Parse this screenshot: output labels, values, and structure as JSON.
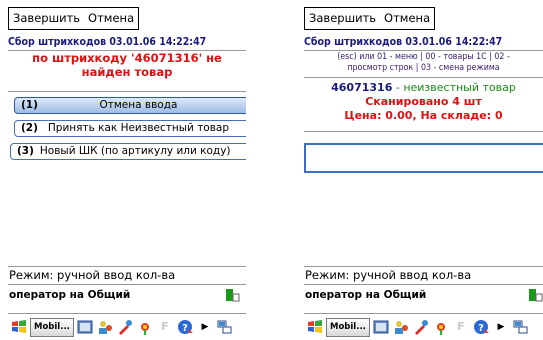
{
  "colors": {
    "error_red": "#e01010",
    "header_blue": "#1a1a80",
    "accent_green": "#1a8a1a",
    "selected_button_blue": "#9ebce6",
    "input_border_blue": "#3a6fc4"
  },
  "left_screen": {
    "menu": {
      "finish_label": "Завершить",
      "cancel_label": "Отмена"
    },
    "header_title": "Сбор штрихкодов 03.01.06 14:22:47",
    "error_message": "по штрихкоду '46071316' не найден товар",
    "options": [
      {
        "num": "(1)",
        "label": "Отмена ввода"
      },
      {
        "num": "(2)",
        "label": "Принять как Неизвестный товар"
      },
      {
        "num": "(3)",
        "label": "Новый ШК (по артикулу или коду)"
      }
    ],
    "mode_text": "Режим: ручной ввод кол-ва",
    "operator_text": "оператор на Общий",
    "taskbar": {
      "app_label": "Mobil..."
    }
  },
  "right_screen": {
    "menu": {
      "finish_label": "Завершить",
      "cancel_label": "Отмена"
    },
    "header_title": "Сбор штрихкодов 03.01.06 14:22:47",
    "hint_line1": "(esc) или 01 - меню | 00 - товары 1С | 02 -",
    "hint_line2": "просмотр строк | 03 - смена режима",
    "barcode": "46071316",
    "barcode_desc": " - неизвестный товар",
    "scanned_text": "Сканировано 4 шт",
    "price_text": "Цена: 0.00, На складе: 0",
    "input_value": "",
    "mode_text": "Режим: ручной ввод кол-ва",
    "operator_text": "оператор на Общий",
    "taskbar": {
      "app_label": "Mobil..."
    }
  },
  "taskbar_icons": [
    "windows-start-icon",
    "folder-icon",
    "user-icon",
    "tools-icon",
    "flower-icon",
    "f-icon",
    "help-icon",
    "arrow-right-icon",
    "network-icon"
  ]
}
